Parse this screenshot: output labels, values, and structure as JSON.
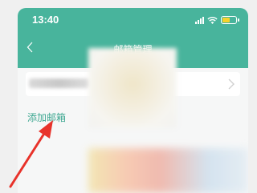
{
  "status_bar": {
    "time": "13:40",
    "battery_level": 0.6,
    "battery_color": "#f7d22b",
    "icons": [
      "signal-icon",
      "wifi-icon",
      "battery-icon"
    ]
  },
  "nav": {
    "title": "邮箱管理",
    "back_icon": "chevron-left-icon"
  },
  "account_row": {
    "icon": "chevron-right-icon"
  },
  "actions": {
    "add_mailbox": "添加邮箱"
  },
  "colors": {
    "header": "#48b49c",
    "link": "#3fa892",
    "annotation_arrow": "#e8322a"
  }
}
